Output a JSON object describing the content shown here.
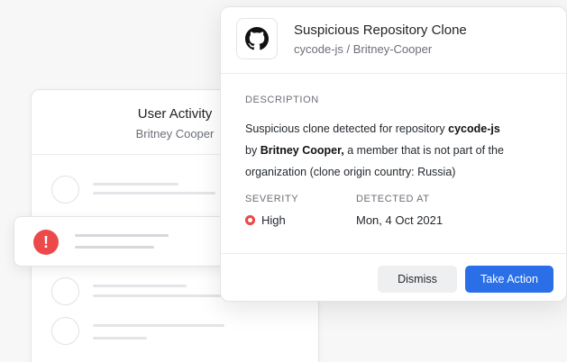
{
  "activity": {
    "title": "User Activity",
    "subtitle": "Britney Cooper"
  },
  "detail": {
    "title": "Suspicious Repository Clone",
    "subtitle": "cycode-js / Britney-Cooper",
    "repo_icon": "github-icon",
    "description_label": "DESCRIPTION",
    "description": {
      "part1": "Suspicious clone detected for repository ",
      "repo": "cycode-js",
      "part2": "by ",
      "user": "Britney Cooper,",
      "part3": " a member that is not part of the organization (clone origin country: Russia)"
    },
    "severity_label": "SEVERITY",
    "severity_value": "High",
    "detected_label": "DETECTED AT",
    "detected_value": "Mon, 4 Oct 2021"
  },
  "actions": {
    "dismiss_label": "Dismiss",
    "take_action_label": "Take Action"
  },
  "colors": {
    "accent": "#2b6fe8",
    "danger": "#ec4a4a"
  }
}
